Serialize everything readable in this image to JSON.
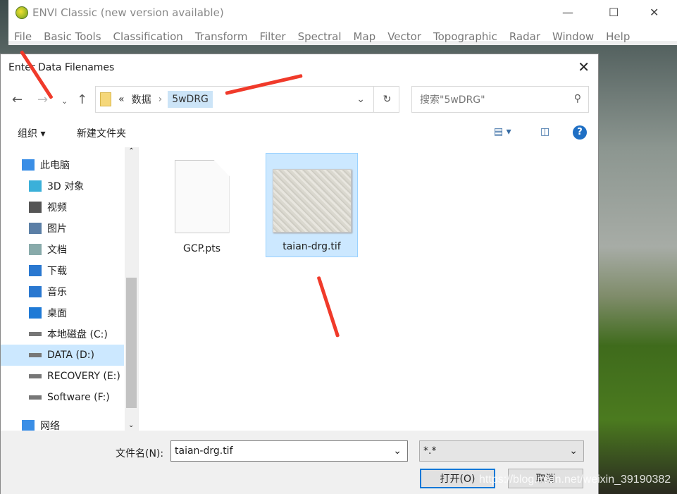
{
  "envi": {
    "title": "ENVI Classic (new version available)",
    "menu": [
      "File",
      "Basic Tools",
      "Classification",
      "Transform",
      "Filter",
      "Spectral",
      "Map",
      "Vector",
      "Topographic",
      "Radar",
      "Window",
      "Help"
    ]
  },
  "dialog": {
    "title": "Enter Data Filenames",
    "address": {
      "overflow": "«",
      "crumbs": [
        "数据",
        "5wDRG"
      ]
    },
    "search_placeholder": "搜索\"5wDRG\"",
    "toolbar": {
      "organize": "组织 ▾",
      "new_folder": "新建文件夹",
      "help": "?"
    },
    "nav": [
      {
        "label": "此电脑",
        "icon": "computer-icon"
      },
      {
        "label": "3D 对象",
        "icon": "cube-icon"
      },
      {
        "label": "视频",
        "icon": "video-icon"
      },
      {
        "label": "图片",
        "icon": "picture-icon"
      },
      {
        "label": "文档",
        "icon": "document-icon"
      },
      {
        "label": "下载",
        "icon": "download-icon"
      },
      {
        "label": "音乐",
        "icon": "music-icon"
      },
      {
        "label": "桌面",
        "icon": "desktop-icon"
      },
      {
        "label": "本地磁盘 (C:)",
        "icon": "drive-icon"
      },
      {
        "label": "DATA (D:)",
        "icon": "drive-icon",
        "selected": true
      },
      {
        "label": "RECOVERY (E:)",
        "icon": "drive-icon"
      },
      {
        "label": "Software (F:)",
        "icon": "drive-icon"
      },
      {
        "label": "网络",
        "icon": "network-icon"
      }
    ],
    "files": [
      {
        "name": "GCP.pts",
        "type": "document"
      },
      {
        "name": "taian-drg.tif",
        "type": "image",
        "selected": true
      }
    ],
    "filename_label": "文件名(N):",
    "filename_value": "taian-drg.tif",
    "filter_value": "*.*",
    "open": "打开(O)",
    "cancel": "取消"
  },
  "watermark": "https://blog.csdn.net/weixin_39190382",
  "colors": {
    "accent": "#0078d7",
    "selection": "#cce8ff",
    "annotation": "#f03a2a"
  }
}
